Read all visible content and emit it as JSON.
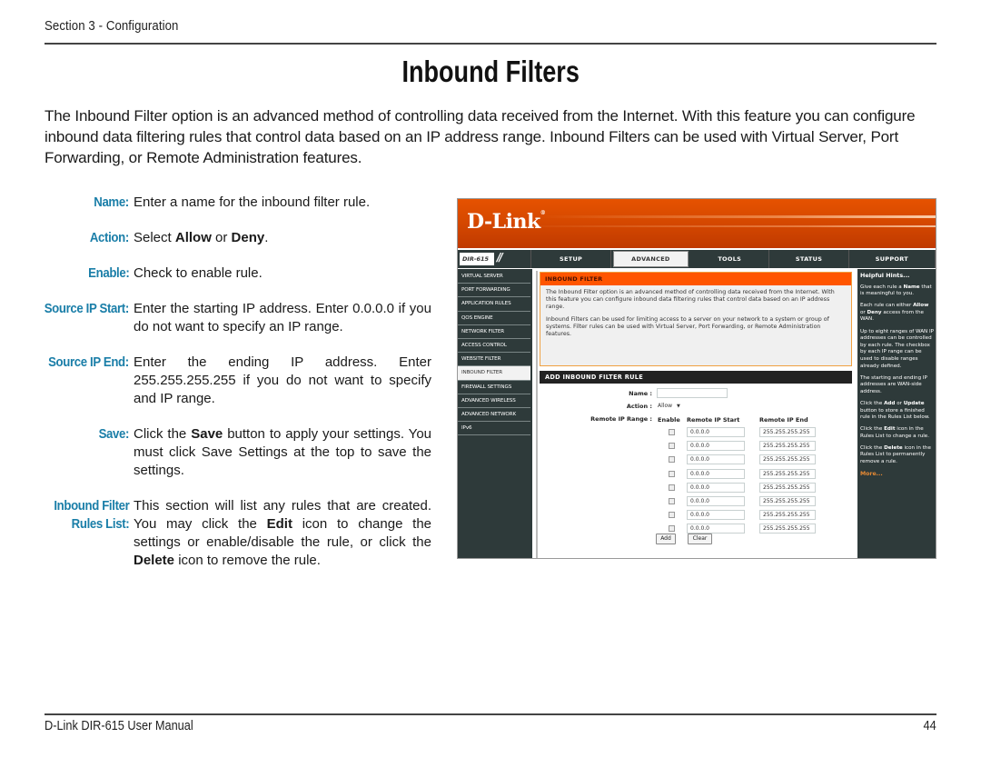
{
  "header": {
    "section": "Section 3 - Configuration"
  },
  "title": "Inbound Filters",
  "intro": "The Inbound Filter option is an advanced method of controlling data received from the Internet. With this feature you can configure inbound data filtering rules that control data based on an IP address range.  Inbound Filters can be used with Virtual Server, Port Forwarding, or Remote Administration features.",
  "definitions": [
    {
      "term": "Name:",
      "parts": [
        {
          "t": "Enter a name for the inbound filter rule."
        }
      ]
    },
    {
      "term": "Action:",
      "parts": [
        {
          "t": "Select "
        },
        {
          "t": "Allow",
          "b": true
        },
        {
          "t": " or "
        },
        {
          "t": "Deny",
          "b": true
        },
        {
          "t": "."
        }
      ]
    },
    {
      "term": "Enable:",
      "parts": [
        {
          "t": "Check to enable rule."
        }
      ]
    },
    {
      "term": "Source IP Start:",
      "parts": [
        {
          "t": "Enter the starting IP address. Enter 0.0.0.0 if you do not want to specify an IP range."
        }
      ]
    },
    {
      "term": "Source IP End:",
      "parts": [
        {
          "t": "Enter the ending IP address. Enter 255.255.255.255 if you do not want to specify and IP range."
        }
      ]
    },
    {
      "term": "Save:",
      "parts": [
        {
          "t": "Click the "
        },
        {
          "t": "Save",
          "b": true
        },
        {
          "t": " button to apply your settings. You must click Save Settings at the top to save the settings."
        }
      ]
    },
    {
      "term": "Inbound Filter Rules List:",
      "term_lines": [
        "Inbound Filter",
        "Rules List:"
      ],
      "parts": [
        {
          "t": "This section will list any rules that are created. You may click the "
        },
        {
          "t": "Edit",
          "b": true
        },
        {
          "t": " icon to change the settings or enable/disable the rule, or click the "
        },
        {
          "t": "Delete",
          "b": true
        },
        {
          "t": " icon to remove the rule."
        }
      ]
    }
  ],
  "router": {
    "logo": "D-Link",
    "model": "DIR-615",
    "tabs": [
      "SETUP",
      "ADVANCED",
      "TOOLS",
      "STATUS",
      "SUPPORT"
    ],
    "active_tab": "ADVANCED",
    "sidebar": [
      "VIRTUAL SERVER",
      "PORT FORWARDING",
      "APPLICATION RULES",
      "QOS ENGINE",
      "NETWORK FILTER",
      "ACCESS CONTROL",
      "WEBSITE FILTER",
      "INBOUND FILTER",
      "FIREWALL SETTINGS",
      "ADVANCED WIRELESS",
      "ADVANCED NETWORK",
      "IPv6"
    ],
    "active_sidebar": "INBOUND FILTER",
    "intro_box": {
      "title": "INBOUND FILTER",
      "p1": "The Inbound Filter option is an advanced method of controlling data received from the Internet. With this feature you can configure inbound data filtering rules that control data based on an IP address range.",
      "p2": "Inbound Filters can be used for limiting access to a server on your network to a system or group of systems. Filter rules can be used with Virtual Server, Port Forwarding, or Remote Administration features."
    },
    "add_rule": {
      "title": "ADD INBOUND FILTER RULE",
      "name_label": "Name :",
      "name_value": "",
      "action_label": "Action :",
      "action_value": "Allow",
      "range_label": "Remote IP Range :",
      "col_enable": "Enable",
      "col_start": "Remote IP Start",
      "col_end": "Remote IP End",
      "rows": [
        {
          "enabled": false,
          "start": "0.0.0.0",
          "end": "255.255.255.255"
        },
        {
          "enabled": false,
          "start": "0.0.0.0",
          "end": "255.255.255.255"
        },
        {
          "enabled": false,
          "start": "0.0.0.0",
          "end": "255.255.255.255"
        },
        {
          "enabled": false,
          "start": "0.0.0.0",
          "end": "255.255.255.255"
        },
        {
          "enabled": false,
          "start": "0.0.0.0",
          "end": "255.255.255.255"
        },
        {
          "enabled": false,
          "start": "0.0.0.0",
          "end": "255.255.255.255"
        },
        {
          "enabled": false,
          "start": "0.0.0.0",
          "end": "255.255.255.255"
        },
        {
          "enabled": false,
          "start": "0.0.0.0",
          "end": "255.255.255.255"
        }
      ],
      "add_label": "Add",
      "clear_label": "Clear"
    },
    "hints": {
      "title": "Helpful Hints...",
      "items": [
        [
          {
            "t": "Give each rule a "
          },
          {
            "t": "Name",
            "b": true
          },
          {
            "t": " that is meaningful to you."
          }
        ],
        [
          {
            "t": "Each rule can either "
          },
          {
            "t": "Allow",
            "b": true
          },
          {
            "t": " or "
          },
          {
            "t": "Deny",
            "b": true
          },
          {
            "t": " access from the WAN."
          }
        ],
        [
          {
            "t": "Up to eight ranges of WAN IP addresses can be controlled by each rule. The checkbox by each IP range can be used to disable ranges already defined."
          }
        ],
        [
          {
            "t": "The starting and ending IP addresses are WAN-side address."
          }
        ],
        [
          {
            "t": "Click the "
          },
          {
            "t": "Add",
            "b": true
          },
          {
            "t": " or "
          },
          {
            "t": "Update",
            "b": true
          },
          {
            "t": " button to store a finished rule in the Rules List below."
          }
        ],
        [
          {
            "t": "Click the "
          },
          {
            "t": "Edit",
            "b": true
          },
          {
            "t": " icon in the Rules List to change a rule."
          }
        ],
        [
          {
            "t": "Click the "
          },
          {
            "t": "Delete",
            "b": true
          },
          {
            "t": " icon in the Rules List to permanently remove a rule."
          }
        ]
      ],
      "more": "More..."
    },
    "colors": {
      "banner": "#d84a00",
      "nav_bg": "#2e3a3a",
      "intro_header": "#ff5500",
      "rule_header": "#222222",
      "more_link": "#e88a33"
    }
  },
  "footer": {
    "manual": "D-Link DIR-615 User Manual",
    "page": "44"
  },
  "colors": {
    "term": "#1a7ea8",
    "text": "#1a1a1a"
  }
}
